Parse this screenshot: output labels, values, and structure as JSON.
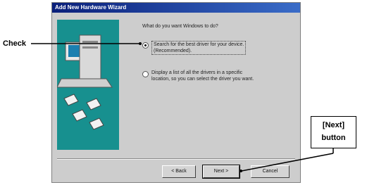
{
  "dialog": {
    "title": "Add New Hardware Wizard",
    "question": "What do you want Windows to do?",
    "option1_line1": "Search for the best driver for your device.",
    "option1_line2": "(Recommended).",
    "option2_line1": "Display a list of all the drivers in a specific",
    "option2_line2": "location, so you can select the driver you want.",
    "selected_option": 1
  },
  "buttons": {
    "back": "< Back",
    "next": "Next >",
    "cancel": "Cancel"
  },
  "callouts": {
    "check": "Check",
    "next_line1": "[Next]",
    "next_line2": "button"
  }
}
